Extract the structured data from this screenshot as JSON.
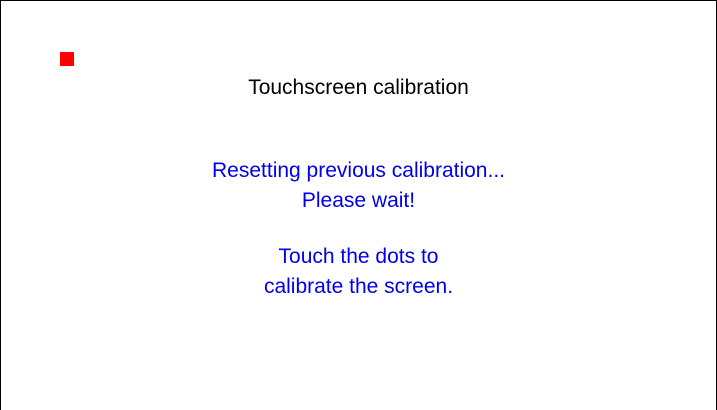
{
  "title": "Touchscreen calibration",
  "status": {
    "line1": "Resetting previous calibration...",
    "line2": "Please wait!"
  },
  "instruction": {
    "line1": "Touch the dots to",
    "line2": "calibrate the screen."
  },
  "colors": {
    "background": "#ffffff",
    "title_text": "#000000",
    "message_text": "#0000ee",
    "calibration_dot": "#ff0000"
  },
  "icons": {
    "calibration_target": "red-square-dot"
  }
}
